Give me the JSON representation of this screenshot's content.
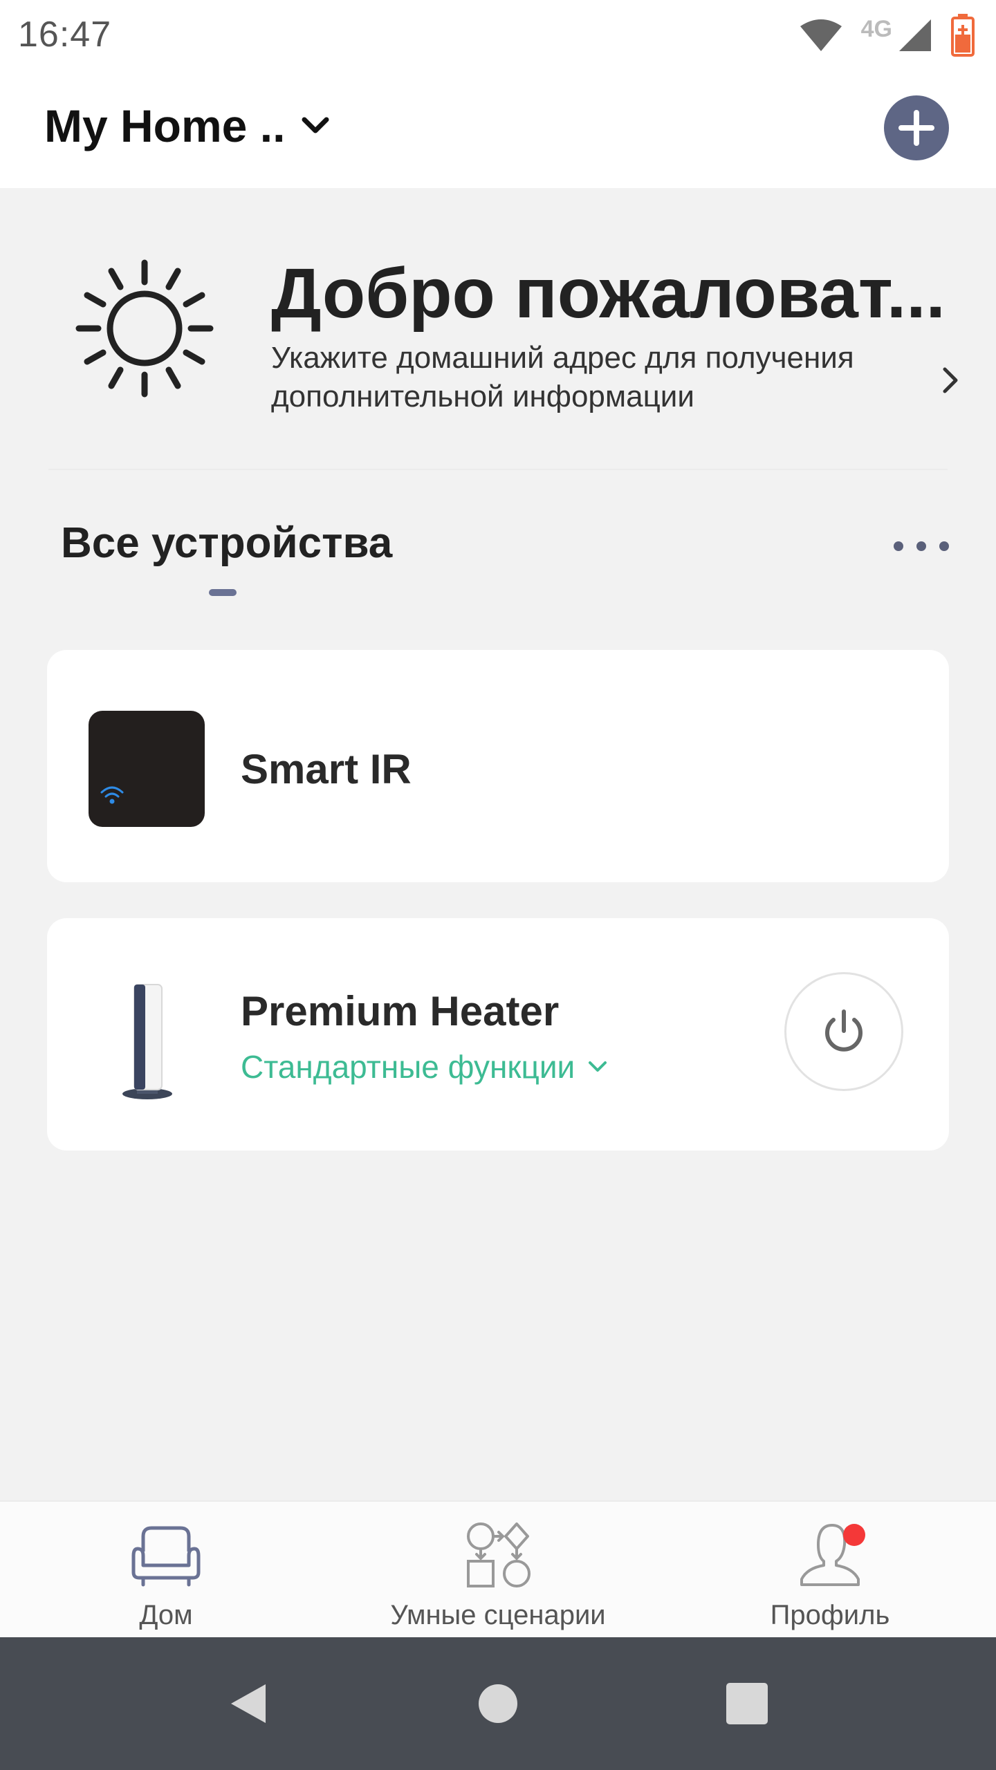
{
  "status_bar": {
    "time": "16:47",
    "network_label": "4G",
    "icons": [
      "wifi-icon",
      "cell-signal-icon",
      "battery-charging-icon"
    ]
  },
  "header": {
    "home_name": "My Home ..",
    "dropdown_icon": "chevron-down-icon",
    "add_icon": "plus-icon"
  },
  "welcome": {
    "icon": "sun-icon",
    "title": "Добро пожаловат...",
    "subtitle": "Укажите домашний адрес для получения дополнительной информации"
  },
  "devices_section": {
    "tab_label": "Все устройства",
    "more_icon": "more-icon"
  },
  "devices": [
    {
      "name": "Smart IR",
      "icon": "ir-hub-icon"
    },
    {
      "name": "Premium Heater",
      "icon": "heater-icon",
      "functions_label": "Стандартные функции",
      "power_icon": "power-icon"
    }
  ],
  "bottom_nav": {
    "items": [
      {
        "label": "Дом",
        "icon": "armchair-icon"
      },
      {
        "label": "Умные сценарии",
        "icon": "scenes-icon"
      },
      {
        "label": "Профиль",
        "icon": "profile-icon",
        "notification": true
      }
    ]
  },
  "colors": {
    "accent": "#5e6685",
    "link_green": "#3dbb93",
    "notification_red": "#f43838",
    "battery_orange": "#f06a3c",
    "system_nav": "#484c53"
  }
}
